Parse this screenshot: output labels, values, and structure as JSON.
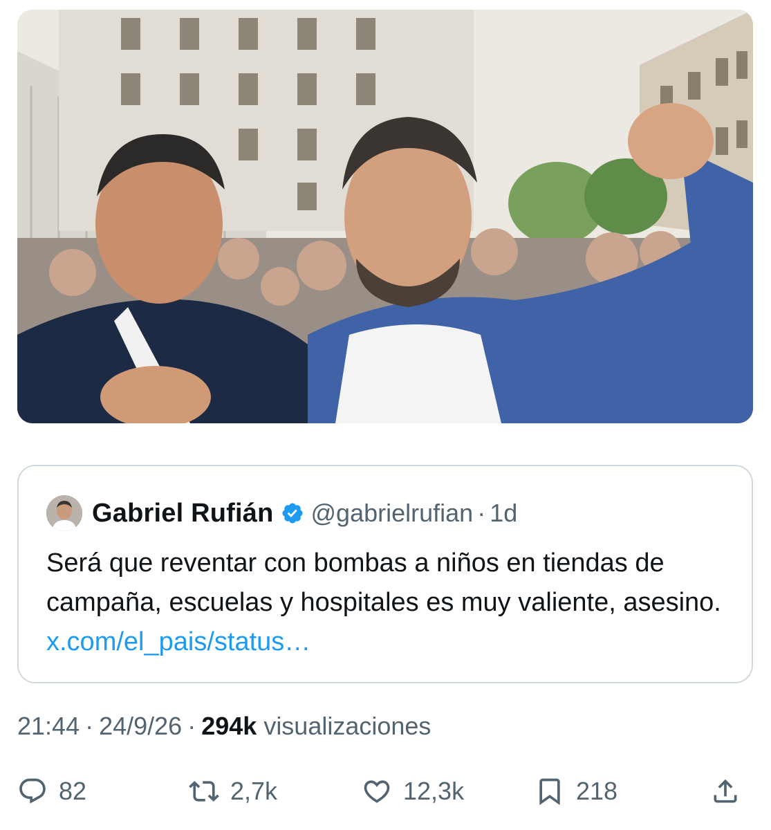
{
  "photo": {
    "alt": "Two men smiling at a street rally; the man on the right raises a fist",
    "icon": "photo"
  },
  "quote": {
    "author_name": "Gabriel Rufián",
    "handle": "@gabrielrufian",
    "separator": "·",
    "time": "1d",
    "text": "Será que reventar con bombas a niños en tiendas de campaña, escuelas y hospitales es muy valiente, asesino.",
    "link": "x.com/el_pais/status…",
    "verified_color": "#1d9bf0"
  },
  "meta": {
    "time": "21:44",
    "separator": "·",
    "date": "24/9/26",
    "views_count": "294k",
    "views_label": "visualizaciones"
  },
  "actions": {
    "replies": "82",
    "retweets": "2,7k",
    "likes": "12,3k",
    "bookmarks": "218"
  },
  "colors": {
    "text": "#0f1419",
    "muted": "#536471",
    "link": "#1d9bf0",
    "border": "#cfd9de"
  }
}
